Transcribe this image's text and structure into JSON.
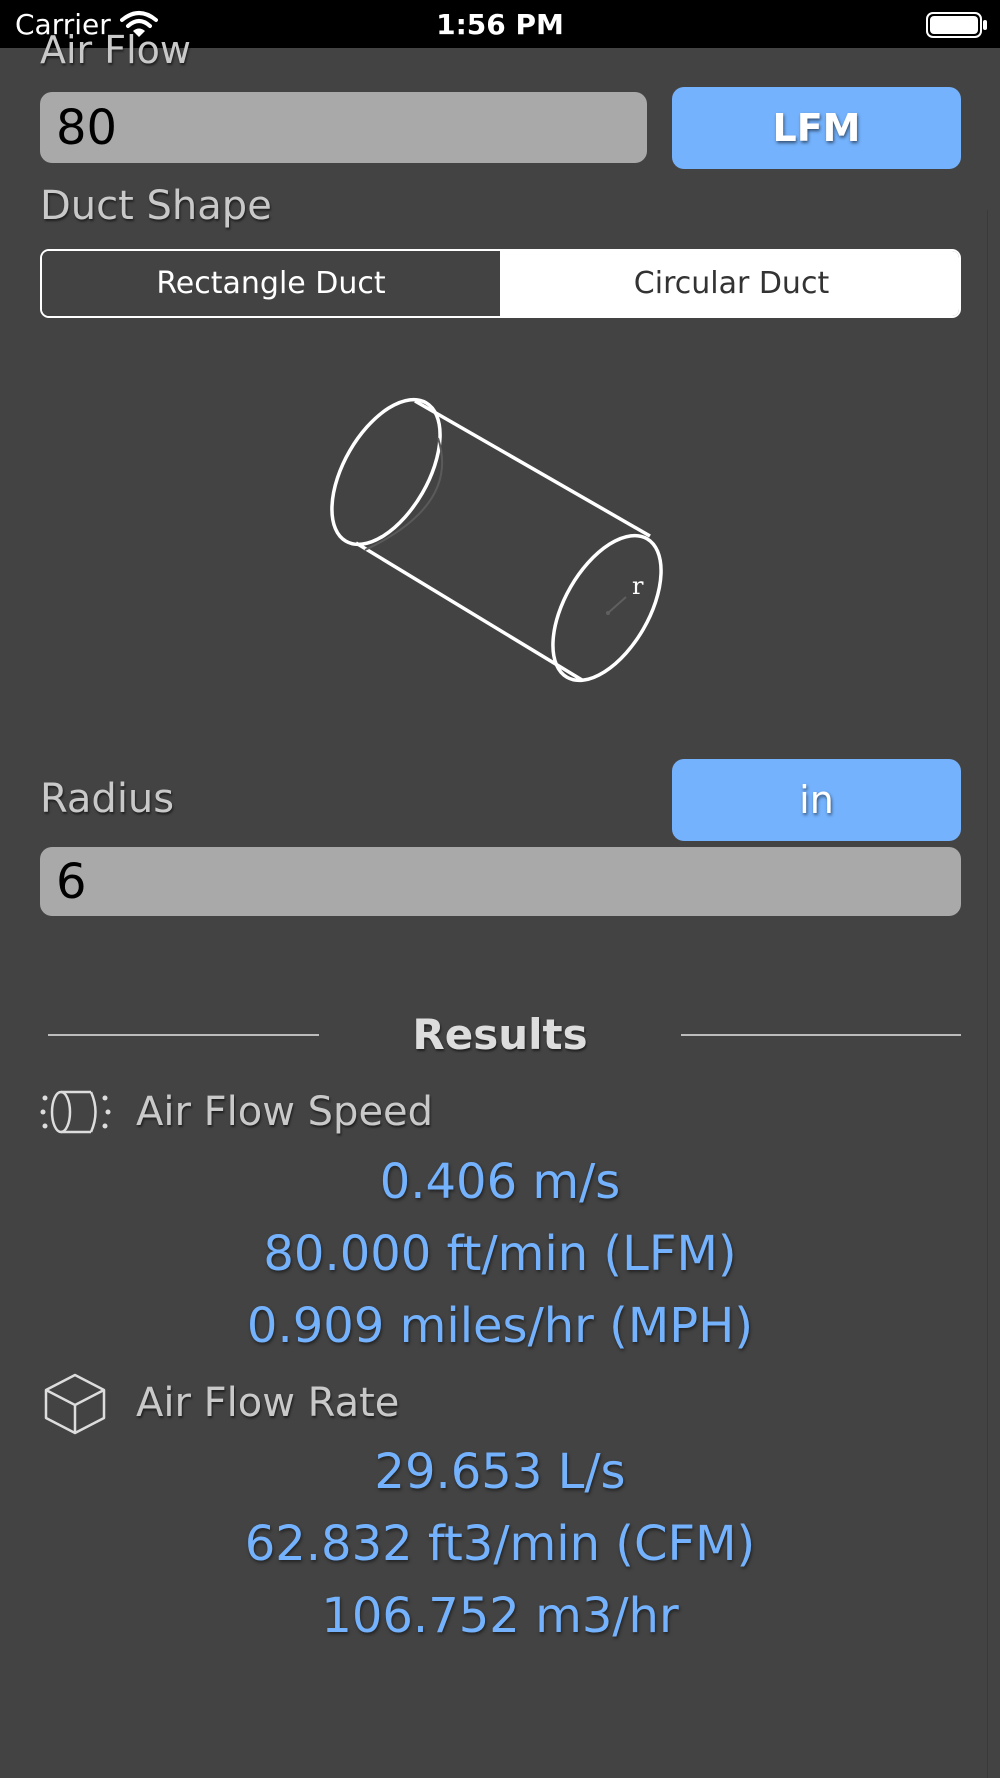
{
  "status_bar": {
    "carrier": "Carrier",
    "time": "1:56 PM"
  },
  "air_flow": {
    "label": "Air Flow",
    "value": "80",
    "unit": "LFM"
  },
  "duct_shape": {
    "label": "Duct Shape",
    "options": [
      "Rectangle Duct",
      "Circular Duct"
    ],
    "selected": "Circular Duct"
  },
  "diagram": {
    "radius_symbol": "r"
  },
  "radius": {
    "label": "Radius",
    "value": "6",
    "unit": "in"
  },
  "results": {
    "title": "Results",
    "speed": {
      "label": "Air Flow Speed",
      "icon": "duct-speed-icon",
      "values": [
        "0.406 m/s",
        "80.000 ft/min (LFM)",
        "0.909 miles/hr (MPH)"
      ]
    },
    "rate": {
      "label": "Air Flow Rate",
      "icon": "cube-icon",
      "values": [
        "29.653 L/s",
        "62.832 ft3/min (CFM)",
        "106.752 m3/hr"
      ]
    }
  },
  "colors": {
    "background": "#434343",
    "accent": "#74b2fd",
    "field": "#a9a9a9"
  }
}
